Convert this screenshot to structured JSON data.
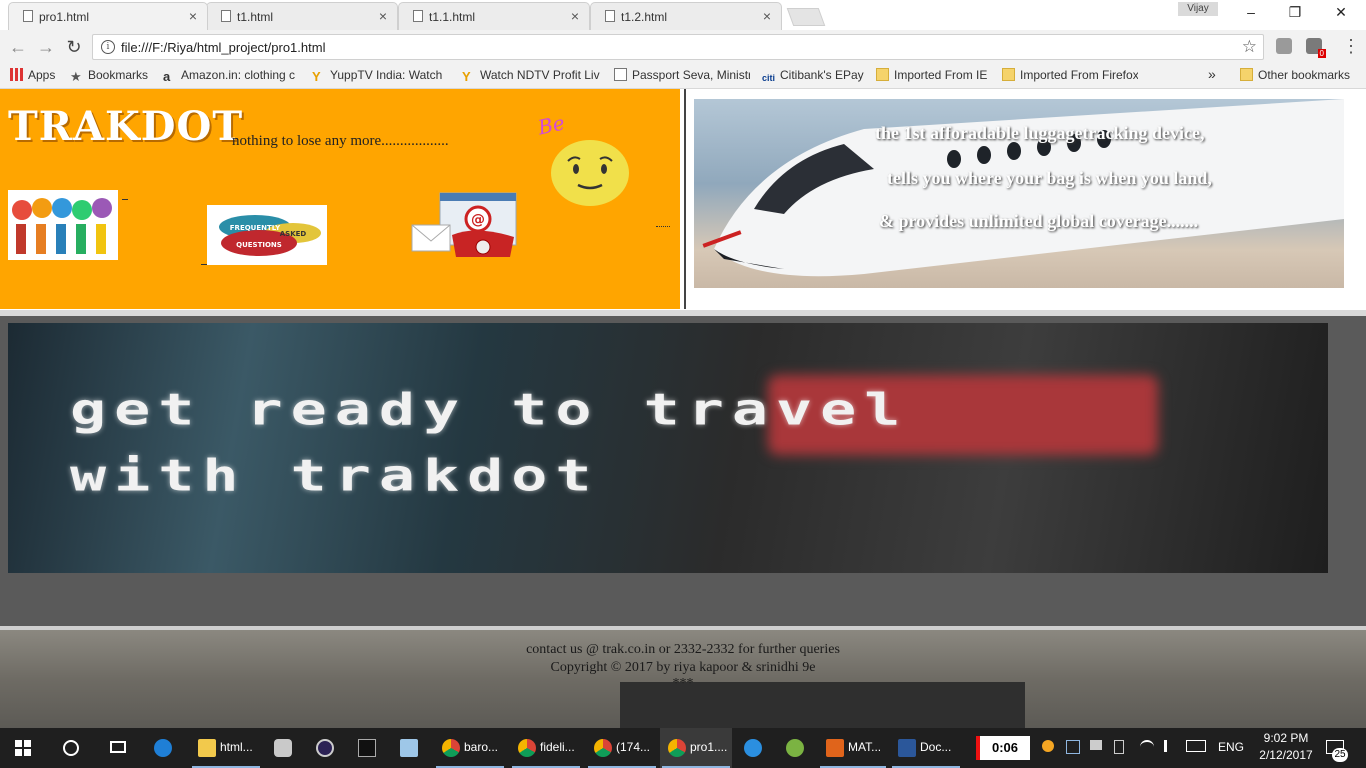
{
  "browser": {
    "tabs": [
      {
        "title": "pro1.html",
        "active": true
      },
      {
        "title": "t1.html",
        "active": false
      },
      {
        "title": "t1.1.html",
        "active": false
      },
      {
        "title": "t1.2.html",
        "active": false
      }
    ],
    "close_glyph": "×",
    "profile_name": "Vijay",
    "window_controls": {
      "minimize": "–",
      "maximize": "❐",
      "close": "✕"
    },
    "url": "file:///F:/Riya/html_project/pro1.html",
    "nav": {
      "back": "←",
      "forward": "→",
      "reload": "↻"
    },
    "star": "☆",
    "menu": "⋮",
    "info_glyph": "i",
    "extension_badge": "0",
    "bookmarks": [
      {
        "label": "Apps",
        "icon": "apps-grid-icon"
      },
      {
        "label": "Bookmarks",
        "icon": "star-icon"
      },
      {
        "label": "Amazon.in: clothing c",
        "icon": "amazon-icon"
      },
      {
        "label": "YuppTV India: Watch",
        "icon": "yupptv-icon"
      },
      {
        "label": "Watch NDTV Profit Liv",
        "icon": "yupptv-icon"
      },
      {
        "label": "Passport Seva, Ministr",
        "icon": "page-icon"
      },
      {
        "label": "Citibank's EPay",
        "icon": "citi-icon"
      },
      {
        "label": "Imported From IE",
        "icon": "folder-icon"
      },
      {
        "label": "Imported From Firefox",
        "icon": "folder-icon"
      }
    ],
    "overflow": "»",
    "other_bookmarks": "Other bookmarks"
  },
  "page": {
    "brand": "TRAKDOT",
    "tagline": "nothing to lose any more..................",
    "be_label": "Be",
    "plane_lines": [
      "the 1st afforadable luggagetracking device,",
      "tells you where your bag is when you land,",
      "& provides unlimited global coverage......."
    ],
    "faq_labels": [
      "FREQUENTLY",
      "ASKED",
      "QUESTIONS"
    ],
    "banner_line1": "get ready to travel",
    "banner_line2": "with trakdot",
    "footer_contact": "contact us @ trak.co.in or 2332-2332 for further queries",
    "footer_copyright": "Copyright © 2017 by riya kapoor & srinidhi 9e",
    "footer_stars": "***"
  },
  "taskbar": {
    "items": [
      {
        "label": "",
        "icon": "windows-start-icon"
      },
      {
        "label": "",
        "icon": "search-circle-icon"
      },
      {
        "label": "",
        "icon": "task-view-icon"
      },
      {
        "label": "",
        "icon": "edge-icon"
      },
      {
        "label": "html...",
        "icon": "folder-icon"
      },
      {
        "label": "",
        "icon": "app-icon"
      },
      {
        "label": "",
        "icon": "eclipse-icon"
      },
      {
        "label": "",
        "icon": "cmd-icon"
      },
      {
        "label": "",
        "icon": "notes-icon"
      },
      {
        "label": "baro...",
        "icon": "chrome-icon"
      },
      {
        "label": "fideli...",
        "icon": "chrome-icon"
      },
      {
        "label": "(174...",
        "icon": "chrome-icon"
      },
      {
        "label": "pro1....",
        "icon": "chrome-icon"
      },
      {
        "label": "",
        "icon": "ie-icon"
      },
      {
        "label": "",
        "icon": "android-icon"
      },
      {
        "label": "MAT...",
        "icon": "matlab-icon"
      },
      {
        "label": "Doc...",
        "icon": "word-icon"
      }
    ],
    "timer": "0:06",
    "language": "ENG",
    "time": "9:02 PM",
    "date": "2/12/2017",
    "notification_count": "25"
  }
}
